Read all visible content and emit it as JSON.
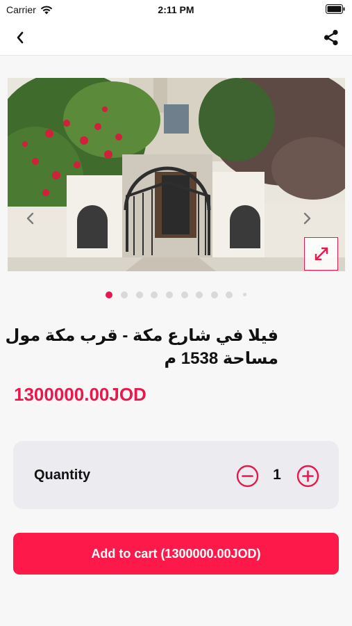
{
  "status_bar": {
    "carrier": "Carrier",
    "time": "2:11 PM"
  },
  "nav": {
    "back_icon": "chevron-left-icon",
    "share_icon": "share-icon"
  },
  "gallery": {
    "image_description": "villa entrance gate with flowering trees",
    "page_count": 10,
    "active_page": 1,
    "prev_icon": "chevron-left-icon",
    "next_icon": "chevron-right-icon",
    "expand_icon": "expand-icon"
  },
  "product": {
    "title": "فيلا في شارع مكة - قرب مكة مول مساحة 1538 م",
    "price": "1300000.00JOD"
  },
  "quantity": {
    "label": "Quantity",
    "value": "1"
  },
  "add_to_cart": {
    "label": "Add to cart (1300000.00JOD)"
  },
  "colors": {
    "accent": "#e8184d",
    "button": "#fd1a4a",
    "card": "#ececf0",
    "background": "#f7f7f7"
  }
}
